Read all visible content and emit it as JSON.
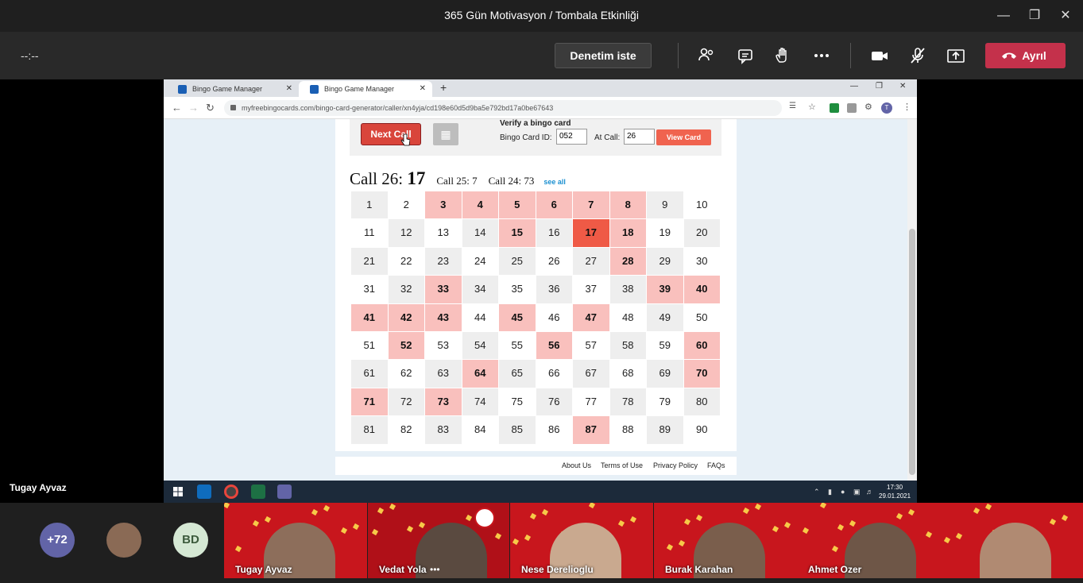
{
  "window": {
    "title": "365 Gün Motivasyon / Tombala Etkinliği"
  },
  "call_bar": {
    "timer": "--:--",
    "control_button": "Denetim iste",
    "leave_button": "Ayrıl"
  },
  "browser": {
    "tabs": [
      {
        "label": "Bingo Game Manager"
      },
      {
        "label": "Bingo Game Manager"
      }
    ],
    "url": "myfreebingocards.com/bingo-card-generator/caller/xn4yja/cd198e60d5d9ba5e792bd17a0be67643",
    "profile_initial": "T"
  },
  "bingo": {
    "next_call_label": "Next Call",
    "verify_title": "Verify a bingo card",
    "card_id_label": "Bingo Card ID:",
    "card_id_value": "052",
    "at_call_label": "At Call:",
    "at_call_value": "26",
    "view_card_label": "View Card",
    "current_call_label": "Call 26:",
    "current_call_number": "17",
    "prev_call_1": "Call 25: 7",
    "prev_call_2": "Call 24: 73",
    "see_all": "see all",
    "numbers": [
      1,
      2,
      3,
      4,
      5,
      6,
      7,
      8,
      9,
      10,
      11,
      12,
      13,
      14,
      15,
      16,
      17,
      18,
      19,
      20,
      21,
      22,
      23,
      24,
      25,
      26,
      27,
      28,
      29,
      30,
      31,
      32,
      33,
      34,
      35,
      36,
      37,
      38,
      39,
      40,
      41,
      42,
      43,
      44,
      45,
      46,
      47,
      48,
      49,
      50,
      51,
      52,
      53,
      54,
      55,
      56,
      57,
      58,
      59,
      60,
      61,
      62,
      63,
      64,
      65,
      66,
      67,
      68,
      69,
      70,
      71,
      72,
      73,
      74,
      75,
      76,
      77,
      78,
      79,
      80,
      81,
      82,
      83,
      84,
      85,
      86,
      87,
      88,
      89,
      90
    ],
    "called": [
      3,
      4,
      5,
      6,
      7,
      8,
      15,
      17,
      18,
      28,
      33,
      39,
      40,
      41,
      42,
      43,
      45,
      47,
      52,
      56,
      60,
      64,
      70,
      71,
      73,
      87
    ],
    "current": 17
  },
  "footer_links": [
    "About Us",
    "Terms of Use",
    "Privacy Policy",
    "FAQs"
  ],
  "taskbar": {
    "time": "17:30",
    "date": "29.01.2021"
  },
  "presenter_name": "Tugay Ayvaz",
  "roster": {
    "overflow_count": "+72",
    "initials": "BD",
    "participants": [
      {
        "name": "Tugay Ayvaz"
      },
      {
        "name": "Vedat Yola"
      },
      {
        "name": "Nese Derelioglu"
      },
      {
        "name": "Burak Karahan"
      },
      {
        "name": "Ahmet Ozer"
      },
      {
        "name": ""
      }
    ]
  },
  "colors": {
    "called": "#f9c0bd",
    "current": "#ef5a46",
    "leave": "#c4314b",
    "accent_purple": "#6264a7"
  }
}
